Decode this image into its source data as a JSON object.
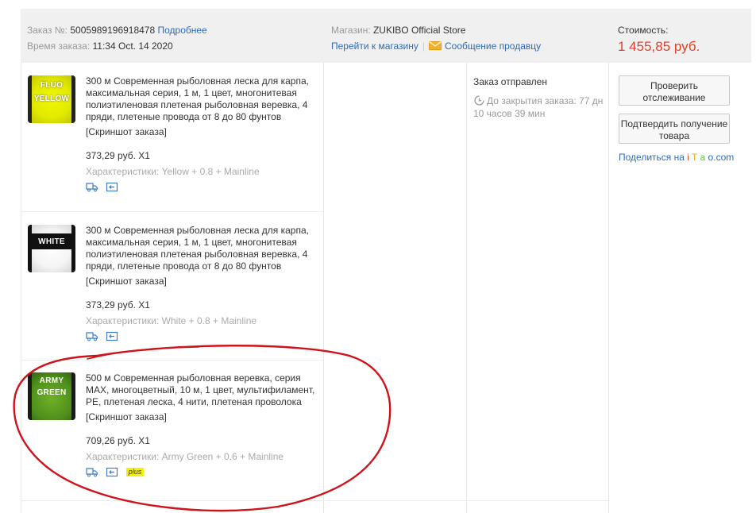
{
  "order": {
    "number_label": "Заказ №:",
    "number_value": "5005989196918478",
    "details_link": "Подробнее",
    "time_label": "Время заказа:",
    "time_value": "11:34 Oct. 14 2020",
    "store_label": "Магазин:",
    "store_name": "ZUKIBO Official Store",
    "go_to_store": "Перейти к магазину",
    "separator": "|",
    "message_seller": "Сообщение продавцу",
    "cost_label": "Стоимость:",
    "cost_value": "1 455,85 руб."
  },
  "items": [
    {
      "thumb_line1": "FLUO",
      "thumb_line2": "YELLOW",
      "title": "300 м Современная рыболовная леска для карпа, максимальная серия, 1 м, 1 цвет, многонитевая полиэтиленовая плетеная рыболовная веревка, 4 пряди, плетеные провода от 8 до 80 фунтов",
      "snapshot": "[Скриншот заказа]",
      "price": "373,29 руб. X1",
      "attributes": "Характеристики: Yellow + 0.8 + Mainline",
      "badge": ""
    },
    {
      "thumb_line1": "WHITE",
      "thumb_line2": "",
      "title": "300 м Современная рыболовная леска для карпа, максимальная серия, 1 м, 1 цвет, многонитевая полиэтиленовая плетеная рыболовная веревка, 4 пряди, плетеные провода от 8 до 80 фунтов",
      "snapshot": "[Скриншот заказа]",
      "price": "373,29 руб. X1",
      "attributes": "Характеристики: White + 0.8 + Mainline",
      "badge": ""
    },
    {
      "thumb_line1": "ARMY",
      "thumb_line2": "GREEN",
      "title": "500 м Современная рыболовная веревка, серия MAX, многоцветный, 10 м, 1 цвет, мультифиламент, PE, плетеная леска, 4 нити, плетеная проволока",
      "snapshot": "[Скриншот заказа]",
      "price": "709,26 руб. X1",
      "attributes": "Характеристики: Army Green + 0.6 + Mainline",
      "badge": "plus"
    }
  ],
  "status": {
    "title": "Заказ отправлен",
    "countdown": "До закрытия заказа: 77 дн 10 часов 39 мин"
  },
  "actions": {
    "track_button": "Проверить отслеживание",
    "confirm_button": "Подтвердить получение товара",
    "share_prefix": "Поделиться на",
    "share_i": "i",
    "share_t": "T",
    "share_a": "a",
    "share_o": "o",
    "share_suffix": ".com"
  },
  "colors": {
    "link": "#2d6bb8",
    "price": "#e0402a",
    "annotation": "#d0121b",
    "plus_badge": "#f6f100"
  },
  "icons": [
    "envelope-icon",
    "clock-icon",
    "delivery-truck-icon",
    "return-icon"
  ]
}
